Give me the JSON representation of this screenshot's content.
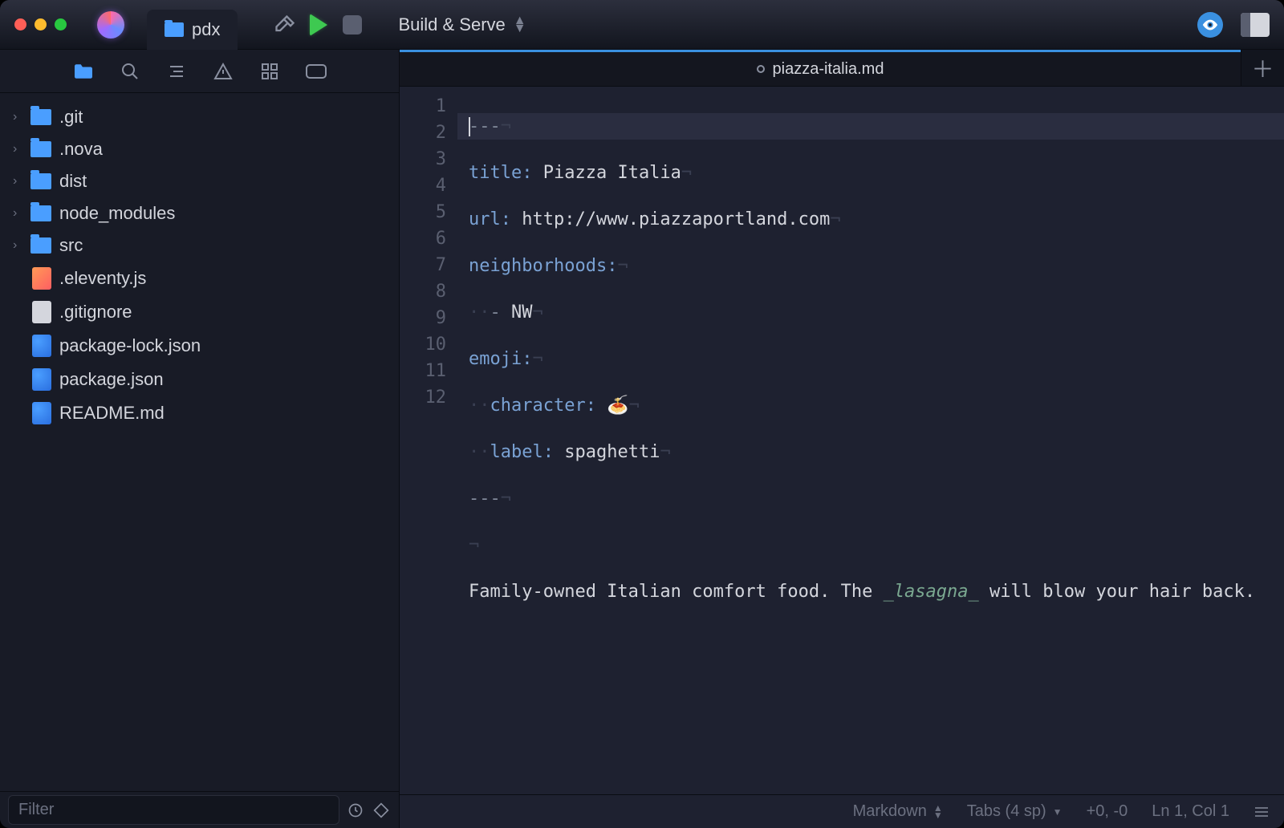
{
  "titlebar": {
    "project_name": "pdx",
    "scheme": "Build & Serve"
  },
  "sidebar": {
    "filter_placeholder": "Filter",
    "tree": {
      "folders": [
        {
          "name": ".git"
        },
        {
          "name": ".nova"
        },
        {
          "name": "dist"
        },
        {
          "name": "node_modules"
        },
        {
          "name": "src"
        }
      ],
      "files": [
        {
          "name": ".eleventy.js",
          "kind": "js"
        },
        {
          "name": ".gitignore",
          "kind": "plain"
        },
        {
          "name": "package-lock.json",
          "kind": "json"
        },
        {
          "name": "package.json",
          "kind": "json"
        },
        {
          "name": "README.md",
          "kind": "md"
        }
      ]
    }
  },
  "tab": {
    "filename": "piazza-italia.md"
  },
  "editor": {
    "line_count": 12,
    "frontmatter_delims": "---",
    "fm": {
      "title_key": "title",
      "title_val": "Piazza Italia",
      "url_key": "url",
      "url_val": "http://www.piazzaportland.com",
      "neighborhoods_key": "neighborhoods",
      "nw_val": "NW",
      "emoji_key": "emoji",
      "char_key": "character",
      "char_val": "🍝",
      "label_key": "label",
      "label_val": "spaghetti"
    },
    "body_pre": "Family-owned Italian comfort food. The ",
    "body_em": "lasagna",
    "body_post": " will blow your hair back."
  },
  "statusbar": {
    "language": "Markdown",
    "indent": "Tabs (4 sp)",
    "diff": "+0, -0",
    "position": "Ln 1, Col 1"
  }
}
